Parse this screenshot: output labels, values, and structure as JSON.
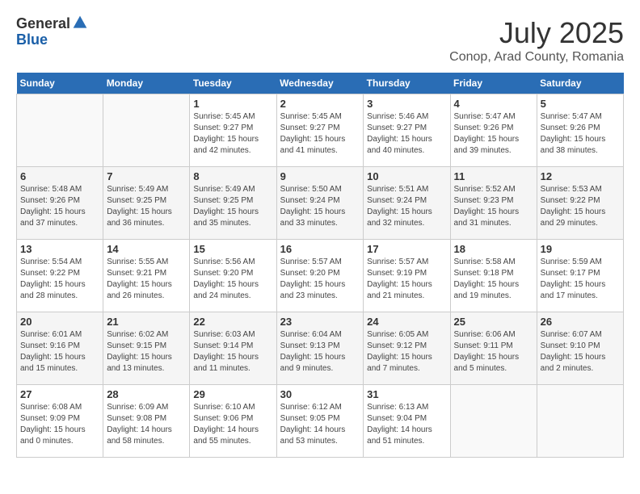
{
  "logo": {
    "general": "General",
    "blue": "Blue"
  },
  "title": {
    "month_year": "July 2025",
    "location": "Conop, Arad County, Romania"
  },
  "calendar": {
    "headers": [
      "Sunday",
      "Monday",
      "Tuesday",
      "Wednesday",
      "Thursday",
      "Friday",
      "Saturday"
    ],
    "weeks": [
      [
        {
          "day": "",
          "sunrise": "",
          "sunset": "",
          "daylight": ""
        },
        {
          "day": "",
          "sunrise": "",
          "sunset": "",
          "daylight": ""
        },
        {
          "day": "1",
          "sunrise": "Sunrise: 5:45 AM",
          "sunset": "Sunset: 9:27 PM",
          "daylight": "Daylight: 15 hours and 42 minutes."
        },
        {
          "day": "2",
          "sunrise": "Sunrise: 5:45 AM",
          "sunset": "Sunset: 9:27 PM",
          "daylight": "Daylight: 15 hours and 41 minutes."
        },
        {
          "day": "3",
          "sunrise": "Sunrise: 5:46 AM",
          "sunset": "Sunset: 9:27 PM",
          "daylight": "Daylight: 15 hours and 40 minutes."
        },
        {
          "day": "4",
          "sunrise": "Sunrise: 5:47 AM",
          "sunset": "Sunset: 9:26 PM",
          "daylight": "Daylight: 15 hours and 39 minutes."
        },
        {
          "day": "5",
          "sunrise": "Sunrise: 5:47 AM",
          "sunset": "Sunset: 9:26 PM",
          "daylight": "Daylight: 15 hours and 38 minutes."
        }
      ],
      [
        {
          "day": "6",
          "sunrise": "Sunrise: 5:48 AM",
          "sunset": "Sunset: 9:26 PM",
          "daylight": "Daylight: 15 hours and 37 minutes."
        },
        {
          "day": "7",
          "sunrise": "Sunrise: 5:49 AM",
          "sunset": "Sunset: 9:25 PM",
          "daylight": "Daylight: 15 hours and 36 minutes."
        },
        {
          "day": "8",
          "sunrise": "Sunrise: 5:49 AM",
          "sunset": "Sunset: 9:25 PM",
          "daylight": "Daylight: 15 hours and 35 minutes."
        },
        {
          "day": "9",
          "sunrise": "Sunrise: 5:50 AM",
          "sunset": "Sunset: 9:24 PM",
          "daylight": "Daylight: 15 hours and 33 minutes."
        },
        {
          "day": "10",
          "sunrise": "Sunrise: 5:51 AM",
          "sunset": "Sunset: 9:24 PM",
          "daylight": "Daylight: 15 hours and 32 minutes."
        },
        {
          "day": "11",
          "sunrise": "Sunrise: 5:52 AM",
          "sunset": "Sunset: 9:23 PM",
          "daylight": "Daylight: 15 hours and 31 minutes."
        },
        {
          "day": "12",
          "sunrise": "Sunrise: 5:53 AM",
          "sunset": "Sunset: 9:22 PM",
          "daylight": "Daylight: 15 hours and 29 minutes."
        }
      ],
      [
        {
          "day": "13",
          "sunrise": "Sunrise: 5:54 AM",
          "sunset": "Sunset: 9:22 PM",
          "daylight": "Daylight: 15 hours and 28 minutes."
        },
        {
          "day": "14",
          "sunrise": "Sunrise: 5:55 AM",
          "sunset": "Sunset: 9:21 PM",
          "daylight": "Daylight: 15 hours and 26 minutes."
        },
        {
          "day": "15",
          "sunrise": "Sunrise: 5:56 AM",
          "sunset": "Sunset: 9:20 PM",
          "daylight": "Daylight: 15 hours and 24 minutes."
        },
        {
          "day": "16",
          "sunrise": "Sunrise: 5:57 AM",
          "sunset": "Sunset: 9:20 PM",
          "daylight": "Daylight: 15 hours and 23 minutes."
        },
        {
          "day": "17",
          "sunrise": "Sunrise: 5:57 AM",
          "sunset": "Sunset: 9:19 PM",
          "daylight": "Daylight: 15 hours and 21 minutes."
        },
        {
          "day": "18",
          "sunrise": "Sunrise: 5:58 AM",
          "sunset": "Sunset: 9:18 PM",
          "daylight": "Daylight: 15 hours and 19 minutes."
        },
        {
          "day": "19",
          "sunrise": "Sunrise: 5:59 AM",
          "sunset": "Sunset: 9:17 PM",
          "daylight": "Daylight: 15 hours and 17 minutes."
        }
      ],
      [
        {
          "day": "20",
          "sunrise": "Sunrise: 6:01 AM",
          "sunset": "Sunset: 9:16 PM",
          "daylight": "Daylight: 15 hours and 15 minutes."
        },
        {
          "day": "21",
          "sunrise": "Sunrise: 6:02 AM",
          "sunset": "Sunset: 9:15 PM",
          "daylight": "Daylight: 15 hours and 13 minutes."
        },
        {
          "day": "22",
          "sunrise": "Sunrise: 6:03 AM",
          "sunset": "Sunset: 9:14 PM",
          "daylight": "Daylight: 15 hours and 11 minutes."
        },
        {
          "day": "23",
          "sunrise": "Sunrise: 6:04 AM",
          "sunset": "Sunset: 9:13 PM",
          "daylight": "Daylight: 15 hours and 9 minutes."
        },
        {
          "day": "24",
          "sunrise": "Sunrise: 6:05 AM",
          "sunset": "Sunset: 9:12 PM",
          "daylight": "Daylight: 15 hours and 7 minutes."
        },
        {
          "day": "25",
          "sunrise": "Sunrise: 6:06 AM",
          "sunset": "Sunset: 9:11 PM",
          "daylight": "Daylight: 15 hours and 5 minutes."
        },
        {
          "day": "26",
          "sunrise": "Sunrise: 6:07 AM",
          "sunset": "Sunset: 9:10 PM",
          "daylight": "Daylight: 15 hours and 2 minutes."
        }
      ],
      [
        {
          "day": "27",
          "sunrise": "Sunrise: 6:08 AM",
          "sunset": "Sunset: 9:09 PM",
          "daylight": "Daylight: 15 hours and 0 minutes."
        },
        {
          "day": "28",
          "sunrise": "Sunrise: 6:09 AM",
          "sunset": "Sunset: 9:08 PM",
          "daylight": "Daylight: 14 hours and 58 minutes."
        },
        {
          "day": "29",
          "sunrise": "Sunrise: 6:10 AM",
          "sunset": "Sunset: 9:06 PM",
          "daylight": "Daylight: 14 hours and 55 minutes."
        },
        {
          "day": "30",
          "sunrise": "Sunrise: 6:12 AM",
          "sunset": "Sunset: 9:05 PM",
          "daylight": "Daylight: 14 hours and 53 minutes."
        },
        {
          "day": "31",
          "sunrise": "Sunrise: 6:13 AM",
          "sunset": "Sunset: 9:04 PM",
          "daylight": "Daylight: 14 hours and 51 minutes."
        },
        {
          "day": "",
          "sunrise": "",
          "sunset": "",
          "daylight": ""
        },
        {
          "day": "",
          "sunrise": "",
          "sunset": "",
          "daylight": ""
        }
      ]
    ]
  }
}
